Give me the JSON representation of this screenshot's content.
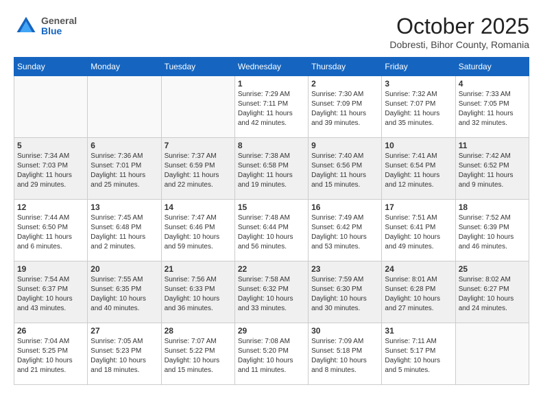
{
  "header": {
    "logo": {
      "general": "General",
      "blue": "Blue"
    },
    "month_title": "October 2025",
    "location": "Dobresti, Bihor County, Romania"
  },
  "days_of_week": [
    "Sunday",
    "Monday",
    "Tuesday",
    "Wednesday",
    "Thursday",
    "Friday",
    "Saturday"
  ],
  "weeks": [
    [
      {
        "day": "",
        "info": ""
      },
      {
        "day": "",
        "info": ""
      },
      {
        "day": "",
        "info": ""
      },
      {
        "day": "1",
        "info": "Sunrise: 7:29 AM\nSunset: 7:11 PM\nDaylight: 11 hours\nand 42 minutes."
      },
      {
        "day": "2",
        "info": "Sunrise: 7:30 AM\nSunset: 7:09 PM\nDaylight: 11 hours\nand 39 minutes."
      },
      {
        "day": "3",
        "info": "Sunrise: 7:32 AM\nSunset: 7:07 PM\nDaylight: 11 hours\nand 35 minutes."
      },
      {
        "day": "4",
        "info": "Sunrise: 7:33 AM\nSunset: 7:05 PM\nDaylight: 11 hours\nand 32 minutes."
      }
    ],
    [
      {
        "day": "5",
        "info": "Sunrise: 7:34 AM\nSunset: 7:03 PM\nDaylight: 11 hours\nand 29 minutes."
      },
      {
        "day": "6",
        "info": "Sunrise: 7:36 AM\nSunset: 7:01 PM\nDaylight: 11 hours\nand 25 minutes."
      },
      {
        "day": "7",
        "info": "Sunrise: 7:37 AM\nSunset: 6:59 PM\nDaylight: 11 hours\nand 22 minutes."
      },
      {
        "day": "8",
        "info": "Sunrise: 7:38 AM\nSunset: 6:58 PM\nDaylight: 11 hours\nand 19 minutes."
      },
      {
        "day": "9",
        "info": "Sunrise: 7:40 AM\nSunset: 6:56 PM\nDaylight: 11 hours\nand 15 minutes."
      },
      {
        "day": "10",
        "info": "Sunrise: 7:41 AM\nSunset: 6:54 PM\nDaylight: 11 hours\nand 12 minutes."
      },
      {
        "day": "11",
        "info": "Sunrise: 7:42 AM\nSunset: 6:52 PM\nDaylight: 11 hours\nand 9 minutes."
      }
    ],
    [
      {
        "day": "12",
        "info": "Sunrise: 7:44 AM\nSunset: 6:50 PM\nDaylight: 11 hours\nand 6 minutes."
      },
      {
        "day": "13",
        "info": "Sunrise: 7:45 AM\nSunset: 6:48 PM\nDaylight: 11 hours\nand 2 minutes."
      },
      {
        "day": "14",
        "info": "Sunrise: 7:47 AM\nSunset: 6:46 PM\nDaylight: 10 hours\nand 59 minutes."
      },
      {
        "day": "15",
        "info": "Sunrise: 7:48 AM\nSunset: 6:44 PM\nDaylight: 10 hours\nand 56 minutes."
      },
      {
        "day": "16",
        "info": "Sunrise: 7:49 AM\nSunset: 6:42 PM\nDaylight: 10 hours\nand 53 minutes."
      },
      {
        "day": "17",
        "info": "Sunrise: 7:51 AM\nSunset: 6:41 PM\nDaylight: 10 hours\nand 49 minutes."
      },
      {
        "day": "18",
        "info": "Sunrise: 7:52 AM\nSunset: 6:39 PM\nDaylight: 10 hours\nand 46 minutes."
      }
    ],
    [
      {
        "day": "19",
        "info": "Sunrise: 7:54 AM\nSunset: 6:37 PM\nDaylight: 10 hours\nand 43 minutes."
      },
      {
        "day": "20",
        "info": "Sunrise: 7:55 AM\nSunset: 6:35 PM\nDaylight: 10 hours\nand 40 minutes."
      },
      {
        "day": "21",
        "info": "Sunrise: 7:56 AM\nSunset: 6:33 PM\nDaylight: 10 hours\nand 36 minutes."
      },
      {
        "day": "22",
        "info": "Sunrise: 7:58 AM\nSunset: 6:32 PM\nDaylight: 10 hours\nand 33 minutes."
      },
      {
        "day": "23",
        "info": "Sunrise: 7:59 AM\nSunset: 6:30 PM\nDaylight: 10 hours\nand 30 minutes."
      },
      {
        "day": "24",
        "info": "Sunrise: 8:01 AM\nSunset: 6:28 PM\nDaylight: 10 hours\nand 27 minutes."
      },
      {
        "day": "25",
        "info": "Sunrise: 8:02 AM\nSunset: 6:27 PM\nDaylight: 10 hours\nand 24 minutes."
      }
    ],
    [
      {
        "day": "26",
        "info": "Sunrise: 7:04 AM\nSunset: 5:25 PM\nDaylight: 10 hours\nand 21 minutes."
      },
      {
        "day": "27",
        "info": "Sunrise: 7:05 AM\nSunset: 5:23 PM\nDaylight: 10 hours\nand 18 minutes."
      },
      {
        "day": "28",
        "info": "Sunrise: 7:07 AM\nSunset: 5:22 PM\nDaylight: 10 hours\nand 15 minutes."
      },
      {
        "day": "29",
        "info": "Sunrise: 7:08 AM\nSunset: 5:20 PM\nDaylight: 10 hours\nand 11 minutes."
      },
      {
        "day": "30",
        "info": "Sunrise: 7:09 AM\nSunset: 5:18 PM\nDaylight: 10 hours\nand 8 minutes."
      },
      {
        "day": "31",
        "info": "Sunrise: 7:11 AM\nSunset: 5:17 PM\nDaylight: 10 hours\nand 5 minutes."
      },
      {
        "day": "",
        "info": ""
      }
    ]
  ]
}
